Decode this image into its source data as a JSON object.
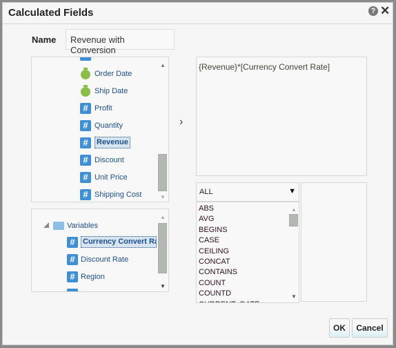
{
  "dialog": {
    "title": "Calculated Fields",
    "help_icon": "?",
    "close_icon": "✕"
  },
  "name": {
    "label": "Name",
    "value": "Revenue with Conversion"
  },
  "fields": [
    {
      "label": "Order Date",
      "icon": "stopwatch-icon"
    },
    {
      "label": "Ship Date",
      "icon": "stopwatch-icon"
    },
    {
      "label": "Profit",
      "icon": "hash-icon"
    },
    {
      "label": "Quantity",
      "icon": "hash-icon"
    },
    {
      "label": "Revenue",
      "icon": "hash-icon",
      "selected": true
    },
    {
      "label": "Discount",
      "icon": "hash-icon"
    },
    {
      "label": "Unit Price",
      "icon": "hash-icon"
    },
    {
      "label": "Shipping Cost",
      "icon": "hash-icon"
    }
  ],
  "variables": {
    "folder": "Variables",
    "items": [
      {
        "label": "Currency Convert Ra",
        "selected": true
      },
      {
        "label": "Discount Rate"
      },
      {
        "label": "Region"
      }
    ]
  },
  "insert_arrow": "›",
  "expression": "{Revenue}*[Currency Convert Rate]",
  "functions": {
    "category": "ALL",
    "items": [
      "ABS",
      "AVG",
      "BEGINS",
      "CASE",
      "CEILING",
      "CONCAT",
      "CONTAINS",
      "COUNT",
      "COUNTD",
      "CURRENT_DATE"
    ]
  },
  "buttons": {
    "ok": "OK",
    "cancel": "Cancel"
  },
  "colors": {
    "accent": "#3f8fd6",
    "date_icon": "#8cbd48",
    "link": "#1f4e8c"
  }
}
